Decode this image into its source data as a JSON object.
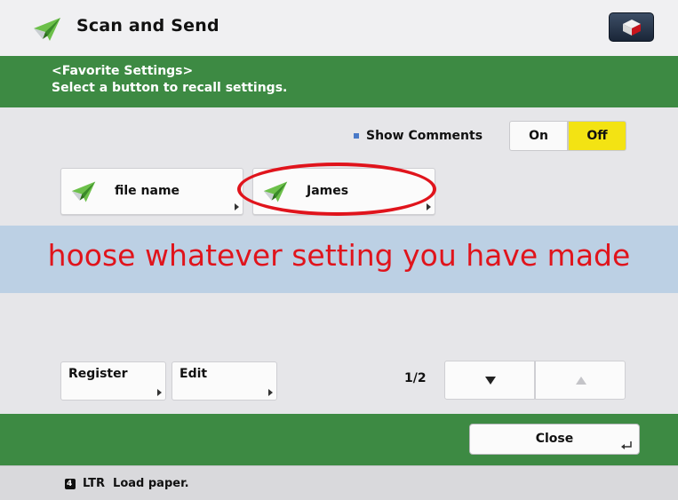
{
  "header": {
    "title": "Scan and Send",
    "app_icon": "paper-plane-icon",
    "corner_icon": "cube-icon"
  },
  "instructions": {
    "line1": "<Favorite Settings>",
    "line2": "Select a button to recall settings."
  },
  "comments": {
    "label": "Show Comments",
    "on_label": "On",
    "off_label": "Off",
    "selected": "Off"
  },
  "favorites": [
    {
      "label": "file name",
      "icon": "paper-plane-icon"
    },
    {
      "label": "James",
      "icon": "paper-plane-icon"
    }
  ],
  "banner": {
    "text": "hoose whatever setting you have made"
  },
  "actions": {
    "register_label": "Register",
    "edit_label": "Edit"
  },
  "pagination": {
    "indicator": "1/2",
    "down_icon": "triangle-down-icon",
    "up_icon": "triangle-up-icon"
  },
  "footer": {
    "close_label": "Close",
    "return_icon": "return-arrow-icon"
  },
  "status": {
    "tray": "4",
    "text": "LTR  Load paper."
  },
  "colors": {
    "green": "#3d8a43",
    "annotation_red": "#e0141c",
    "toggle_selected": "#f3e313",
    "banner_bg": "#bcd0e4"
  }
}
